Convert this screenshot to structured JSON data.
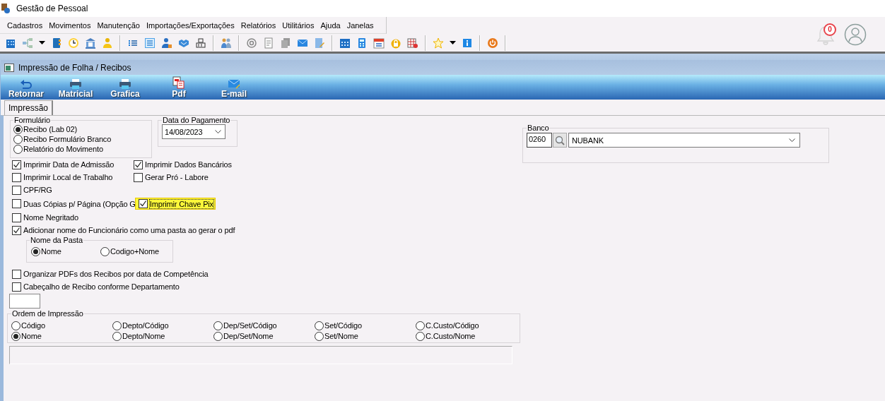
{
  "window": {
    "title": "Gestão de Pessoal"
  },
  "menu": [
    {
      "label": "Cadastros"
    },
    {
      "label": "Movimentos"
    },
    {
      "label": "Manutenção"
    },
    {
      "label": "Importações/Exportações"
    },
    {
      "label": "Relatórios"
    },
    {
      "label": "Utilitários"
    },
    {
      "label": "Ajuda"
    },
    {
      "label": "Janelas"
    }
  ],
  "notifications": {
    "count": "0"
  },
  "child_window": {
    "title": "Impressão de Folha / Recibos"
  },
  "actions": [
    {
      "label": "Retornar",
      "kind": "return"
    },
    {
      "label": "Matricial",
      "kind": "printer"
    },
    {
      "label": "Grafica",
      "kind": "printer"
    },
    {
      "label": "Pdf",
      "kind": "pdf"
    },
    {
      "label": "E-mail",
      "kind": "mail"
    }
  ],
  "tabs": [
    {
      "label": "Impressão",
      "selected": true
    }
  ],
  "formulario": {
    "title": "Formulário",
    "options": [
      {
        "label": "Recibo (Lab 02)",
        "selected": true
      },
      {
        "label": "Recibo Formulário Branco",
        "selected": false
      },
      {
        "label": "Relatório do Movimento",
        "selected": false
      }
    ]
  },
  "data_pagamento": {
    "title": "Data do Pagamento",
    "value": "14/08/2023"
  },
  "check_rows": [
    {
      "items": [
        {
          "label": "Imprimir Data de Admissão",
          "checked": true,
          "highlighted": false
        },
        {
          "label": "Imprimir Dados Bancários",
          "checked": true,
          "highlighted": false
        }
      ]
    },
    {
      "items": [
        {
          "label": "Imprimir Local de Trabalho",
          "checked": false,
          "highlighted": false
        },
        {
          "label": "Gerar Pró - Labore",
          "checked": false,
          "highlighted": false
        }
      ]
    },
    {
      "items": [
        {
          "label": "CPF/RG",
          "checked": false,
          "highlighted": false
        }
      ]
    },
    {
      "items": [
        {
          "label": "Duas Cópias p/ Página (Opção G",
          "checked": false,
          "highlighted": false
        },
        {
          "label": "Imprimir Chave Pix",
          "checked": true,
          "highlighted": true
        }
      ]
    },
    {
      "items": [
        {
          "label": "Nome Negritado",
          "checked": false,
          "highlighted": false
        }
      ]
    },
    {
      "items": [
        {
          "label": "Adicionar nome do Funcionário como uma pasta ao gerar o pdf",
          "checked": true,
          "highlighted": false
        }
      ]
    }
  ],
  "nome_da_pasta": {
    "title": "Nome da Pasta",
    "options": [
      {
        "label": "Nome",
        "selected": true
      },
      {
        "label": "Codigo+Nome",
        "selected": false
      }
    ]
  },
  "more_checks": [
    {
      "label": "Organizar PDFs dos Recibos por data de Competência",
      "checked": false
    },
    {
      "label": "Cabeçalho de Recibo conforme Departamento",
      "checked": false
    }
  ],
  "ordem_impressao": {
    "title": "Ordem de Impressão",
    "options": [
      {
        "label": "Código",
        "selected": false
      },
      {
        "label": "Depto/Código",
        "selected": false
      },
      {
        "label": "Dep/Set/Código",
        "selected": false
      },
      {
        "label": "Set/Código",
        "selected": false
      },
      {
        "label": "C.Custo/Código",
        "selected": false
      },
      {
        "label": "Nome",
        "selected": true
      },
      {
        "label": "Depto/Nome",
        "selected": false
      },
      {
        "label": "Dep/Set/Nome",
        "selected": false
      },
      {
        "label": "Set/Nome",
        "selected": false
      },
      {
        "label": "C.Custo/Nome",
        "selected": false
      }
    ]
  },
  "banco": {
    "title": "Banco",
    "code": "0260",
    "name": "NUBANK"
  }
}
